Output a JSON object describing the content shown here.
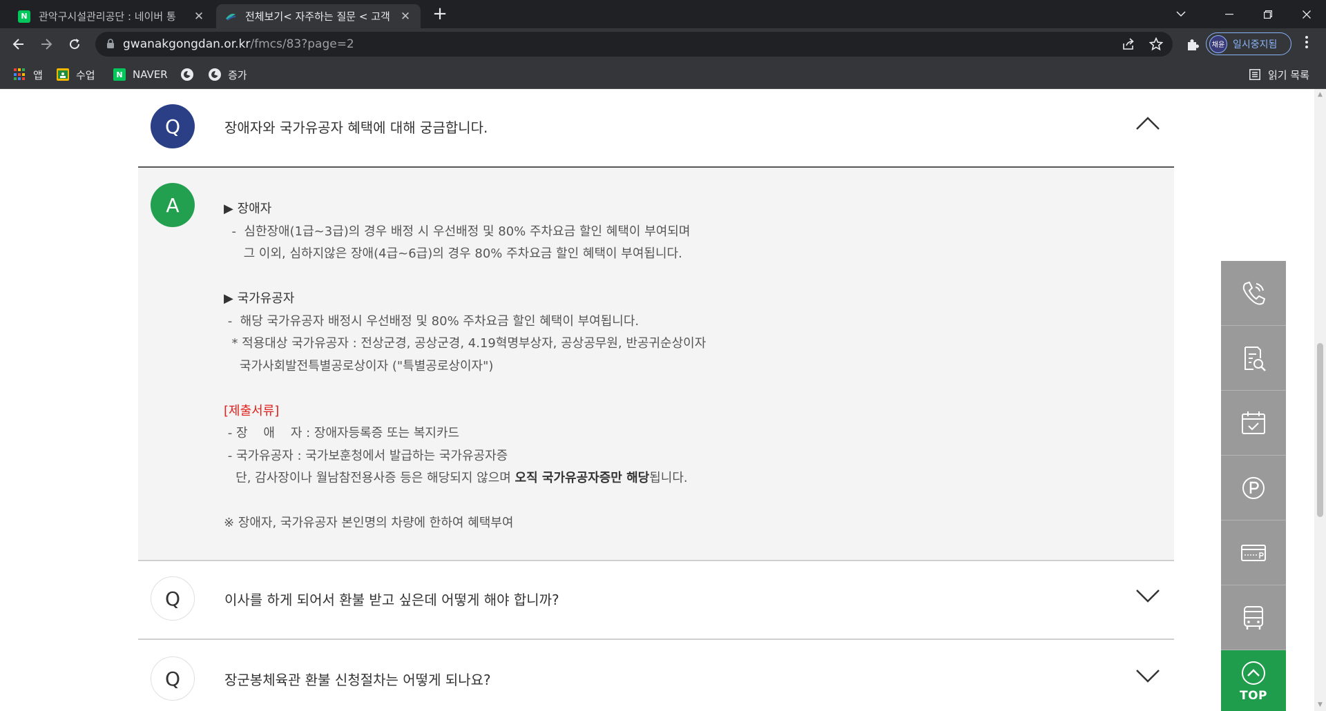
{
  "browser": {
    "tabs": [
      {
        "title": "관악구시설관리공단 : 네이버 통",
        "favicon": "N",
        "active": false
      },
      {
        "title": "전체보기< 자주하는 질문 < 고객",
        "favicon": "",
        "active": true
      }
    ],
    "new_tab": "+",
    "url_host": "gwanakgongdan.or.kr",
    "url_path": "/fmcs/83?page=2",
    "profile_avatar": "채윤",
    "profile_status": "일시중지됨",
    "bookmarks": [
      {
        "label": "앱",
        "icon": "apps-grid-icon"
      },
      {
        "label": "수업",
        "icon": "classroom-icon"
      },
      {
        "label": "NAVER",
        "icon": "naver-icon",
        "favicon": "N"
      },
      {
        "label": "",
        "icon": "globe-icon"
      },
      {
        "label": "증가",
        "icon": "globe-icon"
      }
    ],
    "reading_list": "읽기 목록"
  },
  "faq": {
    "items": [
      {
        "question": "장애자와 국가유공자 혜택에 대해 궁금합니다.",
        "open": true
      },
      {
        "question": "이사를 하게 되어서 환불 받고 싶은데 어떻게 해야 합니까?",
        "open": false
      },
      {
        "question": "장군봉체육관 환불 신청절차는 어떻게 되나요?",
        "open": false
      }
    ],
    "q_letter": "Q",
    "a_letter": "A",
    "answer": {
      "disabled_title": "▶ 장애자",
      "disabled_line1": "  -  심한장애(1급~3급)의 경우 배정 시 우선배정 및 80% 주차요금 할인 혜택이 부여되며",
      "disabled_line2": "     그 이외, 심하지않은 장애(4급~6급)의 경우 80% 주차요금 할인 혜택이 부여됩니다.",
      "veteran_title": "▶ 국가유공자",
      "veteran_line1": " -  해당 국가유공자 배정시 우선배정 및 80% 주차요금 할인 혜택이 부여됩니다.",
      "veteran_line2": "  * 적용대상 국가유공자 : 전상군경, 공상군경, 4.19혁명부상자, 공상공무원, 반공귀순상이자",
      "veteran_line3": "    국가사회발전특별공로상이자 (\"특별공로상이자\")",
      "docs_title": "[제출서류]",
      "docs_line1": " - 장    애    자 : 장애자등록증 또는 복지카드",
      "docs_line2": " - 국가유공자 : 국가보훈청에서 발급하는 국가유공자증",
      "docs_line3_pre": "   단, 감사장이나 월남참전용사증 등은 해당되지 않으며 ",
      "docs_line3_bold": "오직 국가유공자증만 해당",
      "docs_line3_post": "됩니다.",
      "note": "※ 장애자, 국가유공자 본인명의 차량에 한하여 혜택부여"
    }
  },
  "quick_menu": {
    "items": [
      "phone-icon",
      "document-search-icon",
      "calendar-check-icon",
      "parking-icon",
      "parking-card-icon",
      "bus-icon"
    ],
    "top_label": "TOP"
  },
  "colors": {
    "q_badge": "#2a3f86",
    "a_badge": "#23a04f",
    "docs_title": "#e0201b",
    "quick_bg": "#9a9a9a",
    "top_bg": "#1f9d4c"
  }
}
